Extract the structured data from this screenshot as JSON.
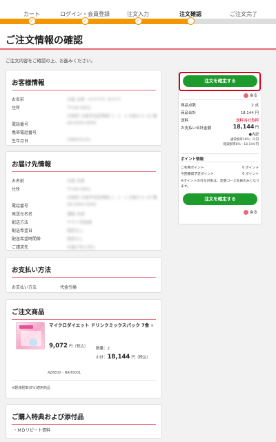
{
  "steps": [
    {
      "label": "カート"
    },
    {
      "label": "ログイン・会員登録"
    },
    {
      "label": "注文入力"
    },
    {
      "label": "注文確認"
    },
    {
      "label": "ご注文完了"
    }
  ],
  "page_title": "ご注文情報の確認",
  "intro": "ご注文内容をご確認の上、お進みください。",
  "customer": {
    "heading": "お客様情報",
    "rows": [
      {
        "key": "お名前",
        "value": "大阪 太郎（オオサカ タロウ）"
      },
      {
        "key": "住所",
        "value": "〒530-0001"
      },
      {
        "key": "",
        "value": "大阪府 大阪市北区梅田 1 - 1 - 1 大阪ビル 10 階"
      },
      {
        "key": "電話番号",
        "value": "06-0000-0000"
      },
      {
        "key": "携帯電話番号",
        "value": ""
      },
      {
        "key": "生年月日",
        "value": "1980/01/01"
      }
    ]
  },
  "delivery": {
    "heading": "お届け先情報",
    "rows": [
      {
        "key": "お名前",
        "value": "大阪 太郎"
      },
      {
        "key": "住所",
        "value": "〒530-0001"
      },
      {
        "key": "",
        "value": "大阪府 大阪市北区梅田 1 - 1 - 1 大阪ビル 10 階"
      },
      {
        "key": "電話番号",
        "value": "06-0000-0000"
      },
      {
        "key": "発送元名名",
        "value": "通販 太郎"
      },
      {
        "key": "配送方法",
        "value": "ヤマト宅急便"
      },
      {
        "key": "配送希望日",
        "value": "指定なし"
      },
      {
        "key": "配送希望時間帯",
        "value": "指定なし"
      },
      {
        "key": "ご請求先",
        "value": "お届け先と同じ"
      }
    ]
  },
  "payment": {
    "heading": "お支払い方法",
    "key": "お支払い方法",
    "value": "代金引換"
  },
  "product": {
    "heading": "ご注文商品",
    "name": "マイクロダイエット ドリンクミックスパック 7食",
    "tax_mark": "※",
    "price": "9,072",
    "price_unit": "円（税込）",
    "qty_label": "数量：",
    "qty": "2",
    "subtotal_label": "小計：",
    "subtotal": "18,144",
    "subtotal_unit": "円（税込）",
    "code": "AZ6E00 - NAH0001",
    "tax_note": "※軽減税率(8%)適用商品"
  },
  "benefits": {
    "heading": "ご購入特典および添付品",
    "item": "・ＭＤリピート資料"
  },
  "summary": {
    "confirm_button": "注文を確定する",
    "back": "戻る",
    "items_label": "商品点数",
    "items_value": "2 点",
    "goods_label": "商品合計",
    "goods_value": "18,144 円",
    "shipping_label": "送料",
    "shipping_value": "送料当社負担",
    "total_label": "お支払い合計金額",
    "total_value": "18,144",
    "total_unit": "円",
    "breakdown_label": "●内訳",
    "tax10": "通常税率10%：0 円",
    "tax8": "軽減税率8%：18,144 円",
    "points_heading": "ポイント情報",
    "points_used_label": "ご利用ポイント",
    "points_used_value": "0 ポイント",
    "points_planned_label": "今回獲得予定ポイント",
    "points_planned_value": "0 ポイント",
    "points_note": "※ポイントの付与対象は、定期コース会員のみとなります。"
  },
  "colors": {
    "accent": "#e56a78",
    "step_bar": "#f39700",
    "button": "#1e9b2d",
    "highlight": "#d6001c"
  }
}
